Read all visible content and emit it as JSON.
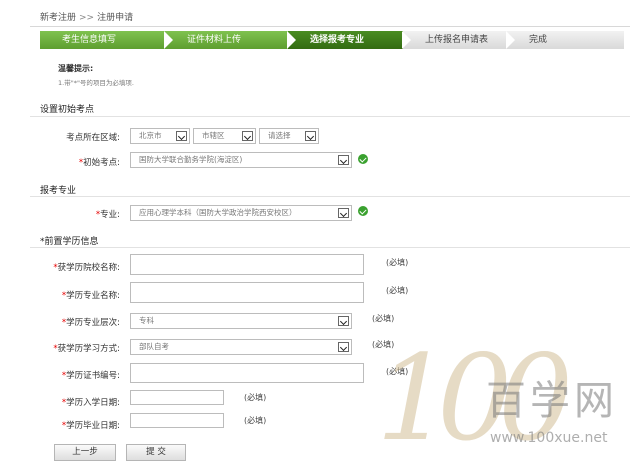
{
  "breadcrumb": {
    "first": "新考注册",
    "separator": ">>",
    "current": "注册申请"
  },
  "steps": [
    {
      "label": "考生信息填写",
      "state": "done"
    },
    {
      "label": "证件材料上传",
      "state": "done"
    },
    {
      "label": "选择报考专业",
      "state": "active"
    },
    {
      "label": "上传报名申请表",
      "state": "todo"
    },
    {
      "label": "完成",
      "state": "todo"
    }
  ],
  "tip": {
    "title": "温馨提示:",
    "text": "1.带\"*\"号的项目为必填项."
  },
  "exam_point": {
    "section_title": "设置初始考点",
    "region_label": "考点所在区域:",
    "region_city": "北京市",
    "region_district": "市辖区",
    "region_third": "请选择",
    "initial_label": "初始考点:",
    "initial_value": "国防大学联合勤务学院(海淀区)"
  },
  "major": {
    "section_title": "报考专业",
    "label": "专业:",
    "value": "应用心理学本科（国防大学政治学院西安校区）"
  },
  "education": {
    "section_title": "前置学历信息",
    "school_label": "获学历院校名称:",
    "major_label": "学历专业名称:",
    "level_label": "学历专业层次:",
    "level_value": "专科",
    "mode_label": "获学历学习方式:",
    "mode_value": "部队自考",
    "cert_label": "学历证书编号:",
    "enroll_label": "学历入学日期:",
    "grad_label": "学历毕业日期:",
    "required_note": "(必填)"
  },
  "buttons": {
    "prev": "上一步",
    "submit": "提 交"
  },
  "watermark": {
    "number": "100",
    "name": "百学网",
    "url": "www.100xue.net"
  },
  "colors": {
    "step_done": "#6ab23a",
    "step_active": "#3f7d1b",
    "step_todo": "#e3e3e3",
    "required": "#e60000",
    "ok": "#3aa12f"
  }
}
